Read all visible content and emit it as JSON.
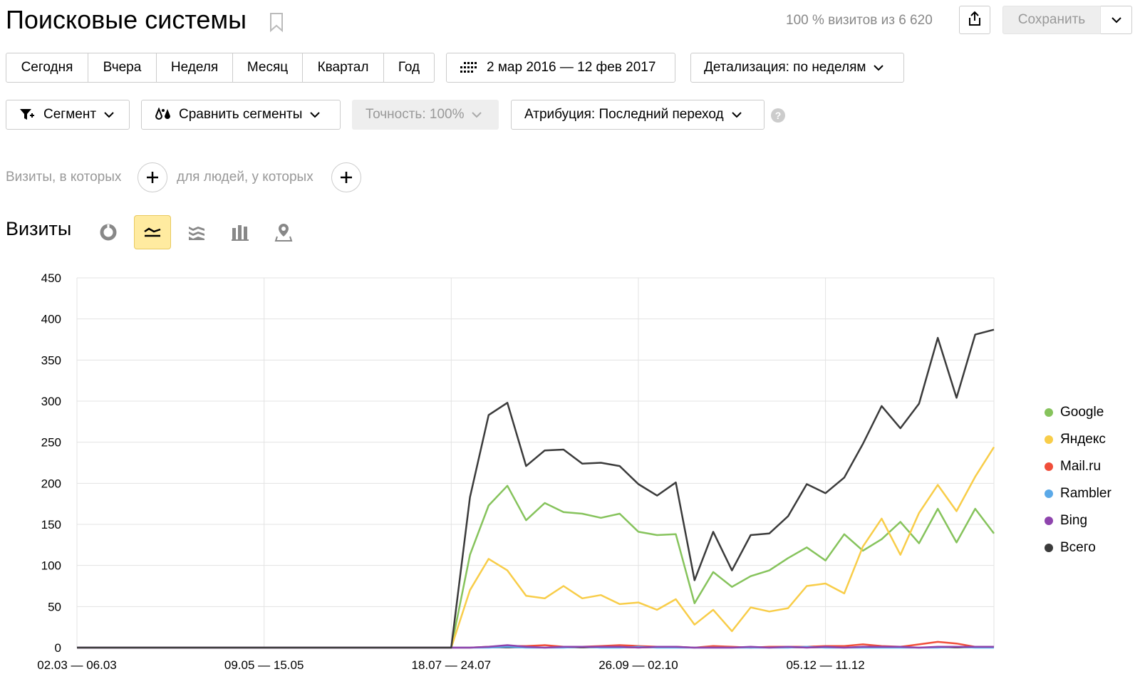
{
  "header": {
    "title": "Поисковые системы",
    "visits_info": "100 % визитов из 6 620",
    "save_label": "Сохранить"
  },
  "periods": [
    "Сегодня",
    "Вчера",
    "Неделя",
    "Месяц",
    "Квартал",
    "Год"
  ],
  "date_range": "2 мар 2016 — 12 фев 2017",
  "detail": "Детализация: по неделям",
  "segment": "Сегмент",
  "compare": "Сравнить сегменты",
  "accuracy": "Точность: 100%",
  "attribution": "Атрибуция: Последний переход",
  "help": "?",
  "filters": {
    "visits_label": "Визиты, в которых",
    "people_label": "для людей, у которых"
  },
  "chart_title": "Визиты",
  "chart_icons": [
    "pie-chart-icon",
    "line-chart-icon",
    "area-chart-icon",
    "bar-chart-icon",
    "map-icon"
  ],
  "colors": {
    "google": "#86c35c",
    "yandex": "#f8cd49",
    "mailru": "#f04e3a",
    "rambler": "#5ba9e8",
    "bing": "#8e44ad",
    "total": "#3b3b3b",
    "active_view": "#ffeba0"
  },
  "chart_data": {
    "type": "line",
    "ylim": [
      0,
      450
    ],
    "yticks": [
      0,
      50,
      100,
      150,
      200,
      250,
      300,
      350,
      400,
      450
    ],
    "xtick_labels": [
      "02.03 — 06.03",
      "09.05 — 15.05",
      "18.07 — 24.07",
      "26.09 — 02.10",
      "05.12 — 11.12"
    ],
    "xtick_index": [
      0,
      10,
      20,
      30,
      40
    ],
    "n_points": 50,
    "legend_position": "right",
    "series": [
      {
        "name": "Google",
        "color": "#86c35c",
        "values": [
          0,
          0,
          0,
          0,
          0,
          0,
          0,
          0,
          0,
          0,
          0,
          0,
          0,
          0,
          0,
          0,
          0,
          0,
          0,
          0,
          0,
          113,
          173,
          197,
          155,
          176,
          165,
          163,
          158,
          163,
          141,
          137,
          138,
          54,
          92,
          74,
          87,
          94,
          109,
          122,
          106,
          138,
          118,
          132,
          153,
          127,
          169,
          128,
          169,
          139
        ]
      },
      {
        "name": "Яндекс",
        "color": "#f8cd49",
        "values": [
          0,
          0,
          0,
          0,
          0,
          0,
          0,
          0,
          0,
          0,
          0,
          0,
          0,
          0,
          0,
          0,
          0,
          0,
          0,
          0,
          0,
          70,
          108,
          94,
          63,
          60,
          75,
          60,
          64,
          53,
          55,
          46,
          59,
          28,
          46,
          20,
          49,
          44,
          48,
          75,
          78,
          66,
          123,
          157,
          113,
          164,
          198,
          166,
          208,
          244
        ]
      },
      {
        "name": "Mail.ru",
        "color": "#f04e3a",
        "values": [
          0,
          0,
          0,
          0,
          0,
          0,
          0,
          0,
          0,
          0,
          0,
          0,
          0,
          0,
          0,
          0,
          0,
          0,
          0,
          0,
          0,
          0,
          1,
          2,
          2,
          3,
          1,
          1,
          2,
          3,
          2,
          1,
          1,
          0,
          2,
          1,
          0,
          1,
          1,
          1,
          2,
          2,
          4,
          2,
          1,
          4,
          7,
          5,
          1,
          1
        ]
      },
      {
        "name": "Rambler",
        "color": "#5ba9e8",
        "values": [
          0,
          0,
          0,
          0,
          0,
          0,
          0,
          0,
          0,
          0,
          0,
          0,
          0,
          0,
          0,
          0,
          0,
          0,
          0,
          0,
          0,
          0,
          0,
          1,
          0,
          0,
          0,
          1,
          0,
          0,
          1,
          0,
          0,
          0,
          0,
          0,
          0,
          0,
          0,
          1,
          0,
          0,
          0,
          0,
          0,
          0,
          0,
          1,
          0,
          0
        ]
      },
      {
        "name": "Bing",
        "color": "#8e44ad",
        "values": [
          0,
          0,
          0,
          0,
          0,
          0,
          0,
          0,
          0,
          0,
          0,
          0,
          0,
          0,
          0,
          0,
          0,
          0,
          0,
          0,
          0,
          0,
          1,
          3,
          1,
          0,
          1,
          1,
          1,
          1,
          0,
          1,
          1,
          0,
          0,
          0,
          1,
          0,
          1,
          0,
          1,
          0,
          1,
          1,
          1,
          0,
          1,
          1,
          1,
          1
        ]
      },
      {
        "name": "Всего",
        "color": "#3b3b3b",
        "values": [
          0,
          0,
          0,
          0,
          0,
          0,
          0,
          0,
          0,
          0,
          0,
          0,
          0,
          0,
          0,
          0,
          0,
          0,
          0,
          0,
          0,
          183,
          283,
          298,
          221,
          240,
          241,
          224,
          225,
          221,
          199,
          185,
          201,
          82,
          141,
          94,
          137,
          139,
          160,
          199,
          188,
          207,
          248,
          294,
          267,
          297,
          377,
          304,
          381,
          387
        ]
      }
    ]
  }
}
